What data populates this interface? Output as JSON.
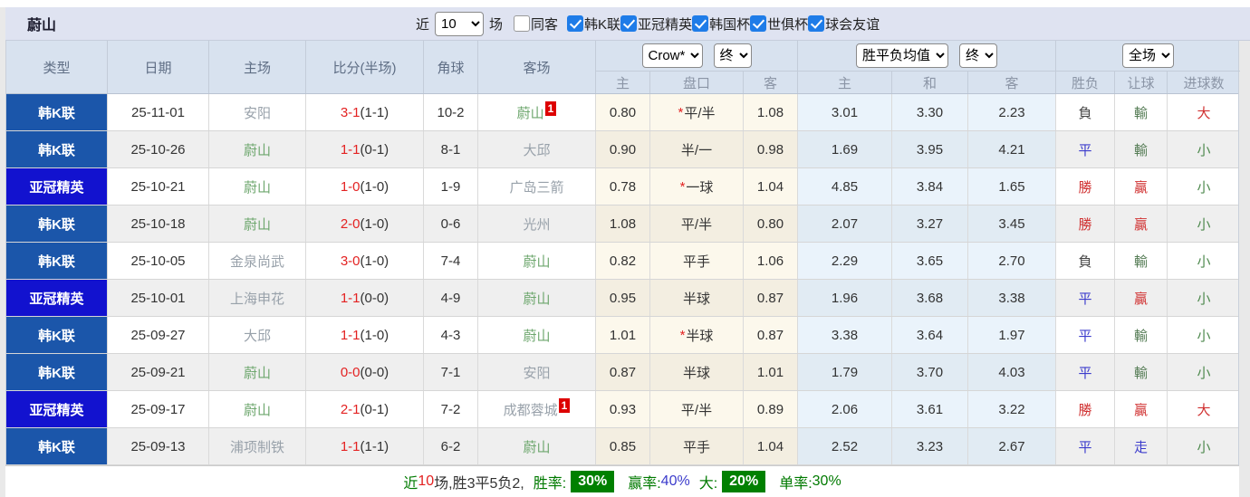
{
  "title": "蔚山",
  "filters": {
    "near_label": "近",
    "games_value": "10",
    "games_unit": "场",
    "same_away": {
      "label": "同客",
      "checked": false
    },
    "leagues": [
      {
        "label": "韩K联",
        "checked": true
      },
      {
        "label": "亚冠精英",
        "checked": true
      },
      {
        "label": "韩国杯",
        "checked": true
      },
      {
        "label": "世俱杯",
        "checked": true
      },
      {
        "label": "球会友谊",
        "checked": true
      }
    ]
  },
  "table": {
    "headers": {
      "type": "类型",
      "date": "日期",
      "home": "主场",
      "score": "比分(半场)",
      "corner": "角球",
      "away": "客场"
    },
    "selects": {
      "bookmaker": "Crow*",
      "handicap_state": "终",
      "avg": "胜平负均值",
      "avg_state": "终",
      "scope": "全场"
    },
    "sub_headers": [
      "主",
      "盘口",
      "客",
      "主",
      "和",
      "客",
      "胜负",
      "让球",
      "进球数"
    ],
    "rows": [
      {
        "league": "韩K联",
        "league_style": "k",
        "date": "25-11-01",
        "home": "安阳",
        "home_style": "gray",
        "score_ft": "3-1",
        "score_ht": "(1-1)",
        "corner": "10-2",
        "away": "蔚山",
        "away_style": "green",
        "away_badge": "1",
        "odds_home": "0.80",
        "handicap": "平/半",
        "handicap_star": true,
        "odds_away": "1.08",
        "avg_home": "3.01",
        "avg_draw": "3.30",
        "avg_away": "2.23",
        "result": "負",
        "result_style": "loss",
        "handicap_result": "輸",
        "handicap_result_style": "lose",
        "goals": "大",
        "goals_style": "big"
      },
      {
        "league": "韩K联",
        "league_style": "k",
        "date": "25-10-26",
        "home": "蔚山",
        "home_style": "green",
        "score_ft": "1-1",
        "score_ht": "(0-1)",
        "corner": "8-1",
        "away": "大邱",
        "away_style": "gray",
        "away_badge": "",
        "odds_home": "0.90",
        "handicap": "半/一",
        "handicap_star": false,
        "odds_away": "0.98",
        "avg_home": "1.69",
        "avg_draw": "3.95",
        "avg_away": "4.21",
        "result": "平",
        "result_style": "draw",
        "handicap_result": "輸",
        "handicap_result_style": "lose",
        "goals": "小",
        "goals_style": "small"
      },
      {
        "league": "亚冠精英",
        "league_style": "a",
        "date": "25-10-21",
        "home": "蔚山",
        "home_style": "green",
        "score_ft": "1-0",
        "score_ht": "(1-0)",
        "corner": "1-9",
        "away": "广岛三箭",
        "away_style": "gray",
        "away_badge": "",
        "odds_home": "0.78",
        "handicap": "一球",
        "handicap_star": true,
        "odds_away": "1.04",
        "avg_home": "4.85",
        "avg_draw": "3.84",
        "avg_away": "1.65",
        "result": "勝",
        "result_style": "win",
        "handicap_result": "贏",
        "handicap_result_style": "win",
        "goals": "小",
        "goals_style": "small"
      },
      {
        "league": "韩K联",
        "league_style": "k",
        "date": "25-10-18",
        "home": "蔚山",
        "home_style": "green",
        "score_ft": "2-0",
        "score_ht": "(1-0)",
        "corner": "0-6",
        "away": "光州",
        "away_style": "gray",
        "away_badge": "",
        "odds_home": "1.08",
        "handicap": "平/半",
        "handicap_star": false,
        "odds_away": "0.80",
        "avg_home": "2.07",
        "avg_draw": "3.27",
        "avg_away": "3.45",
        "result": "勝",
        "result_style": "win",
        "handicap_result": "贏",
        "handicap_result_style": "win",
        "goals": "小",
        "goals_style": "small"
      },
      {
        "league": "韩K联",
        "league_style": "k",
        "date": "25-10-05",
        "home": "金泉尚武",
        "home_style": "gray",
        "score_ft": "3-0",
        "score_ht": "(1-0)",
        "corner": "7-4",
        "away": "蔚山",
        "away_style": "green",
        "away_badge": "",
        "odds_home": "0.82",
        "handicap": "平手",
        "handicap_star": false,
        "odds_away": "1.06",
        "avg_home": "2.29",
        "avg_draw": "3.65",
        "avg_away": "2.70",
        "result": "負",
        "result_style": "loss",
        "handicap_result": "輸",
        "handicap_result_style": "lose",
        "goals": "小",
        "goals_style": "small"
      },
      {
        "league": "亚冠精英",
        "league_style": "a",
        "date": "25-10-01",
        "home": "上海申花",
        "home_style": "gray",
        "score_ft": "1-1",
        "score_ht": "(0-0)",
        "corner": "4-9",
        "away": "蔚山",
        "away_style": "green",
        "away_badge": "",
        "odds_home": "0.95",
        "handicap": "半球",
        "handicap_star": false,
        "odds_away": "0.87",
        "avg_home": "1.96",
        "avg_draw": "3.68",
        "avg_away": "3.38",
        "result": "平",
        "result_style": "draw",
        "handicap_result": "贏",
        "handicap_result_style": "win",
        "goals": "小",
        "goals_style": "small"
      },
      {
        "league": "韩K联",
        "league_style": "k",
        "date": "25-09-27",
        "home": "大邱",
        "home_style": "gray",
        "score_ft": "1-1",
        "score_ht": "(1-0)",
        "corner": "4-3",
        "away": "蔚山",
        "away_style": "green",
        "away_badge": "",
        "odds_home": "1.01",
        "handicap": "半球",
        "handicap_star": true,
        "odds_away": "0.87",
        "avg_home": "3.38",
        "avg_draw": "3.64",
        "avg_away": "1.97",
        "result": "平",
        "result_style": "draw",
        "handicap_result": "輸",
        "handicap_result_style": "lose",
        "goals": "小",
        "goals_style": "small"
      },
      {
        "league": "韩K联",
        "league_style": "k",
        "date": "25-09-21",
        "home": "蔚山",
        "home_style": "green",
        "score_ft": "0-0",
        "score_ht": "(0-0)",
        "corner": "7-1",
        "away": "安阳",
        "away_style": "gray",
        "away_badge": "",
        "odds_home": "0.87",
        "handicap": "半球",
        "handicap_star": false,
        "odds_away": "1.01",
        "avg_home": "1.79",
        "avg_draw": "3.70",
        "avg_away": "4.03",
        "result": "平",
        "result_style": "draw",
        "handicap_result": "輸",
        "handicap_result_style": "lose",
        "goals": "小",
        "goals_style": "small"
      },
      {
        "league": "亚冠精英",
        "league_style": "a",
        "date": "25-09-17",
        "home": "蔚山",
        "home_style": "green",
        "score_ft": "2-1",
        "score_ht": "(0-1)",
        "corner": "7-2",
        "away": "成都蓉城",
        "away_style": "gray",
        "away_badge": "1",
        "odds_home": "0.93",
        "handicap": "平/半",
        "handicap_star": false,
        "odds_away": "0.89",
        "avg_home": "2.06",
        "avg_draw": "3.61",
        "avg_away": "3.22",
        "result": "勝",
        "result_style": "win",
        "handicap_result": "贏",
        "handicap_result_style": "win",
        "goals": "大",
        "goals_style": "big"
      },
      {
        "league": "韩K联",
        "league_style": "k",
        "date": "25-09-13",
        "home": "浦项制铁",
        "home_style": "gray",
        "score_ft": "1-1",
        "score_ht": "(1-1)",
        "corner": "6-2",
        "away": "蔚山",
        "away_style": "green",
        "away_badge": "",
        "odds_home": "0.85",
        "handicap": "平手",
        "handicap_star": false,
        "odds_away": "1.04",
        "avg_home": "2.52",
        "avg_draw": "3.23",
        "avg_away": "2.67",
        "result": "平",
        "result_style": "draw",
        "handicap_result": "走",
        "handicap_result_style": "push",
        "goals": "小",
        "goals_style": "small"
      }
    ]
  },
  "footer": {
    "summary_prefix": "近",
    "summary_count": "10",
    "summary_rest": "场,胜3平5负2,",
    "win_rate_label": "胜率:",
    "win_rate": "30%",
    "profit_rate_label": "赢率:",
    "profit_rate": "40%",
    "big_label": "大:",
    "big_rate": "20%",
    "single_rate_label": "单率:",
    "single_rate": "30%"
  },
  "colors": {
    "league_k_bg": "#1b56aa",
    "league_acl_bg": "#1212cf",
    "win_red": "#d03030",
    "draw_blue": "#3c3ccc",
    "loss_dark": "#444444",
    "team_green": "#6ea76e",
    "team_gray": "#98a1aa",
    "score_red": "#e32222",
    "handicap_lose_green": "#567d56",
    "goals_green": "#4f8a4f",
    "footer_green": "#007a00",
    "badge_red": "#dd0000",
    "rate_badge_green": "#008000",
    "checkbox_blue": "#1e7ce8",
    "odds_cream_bg": "#fcf8ec",
    "avg_blue_bg": "#eaf3fb",
    "header_bg": "#d8e2ef",
    "titlebar_bg": "#dfe3f1"
  }
}
